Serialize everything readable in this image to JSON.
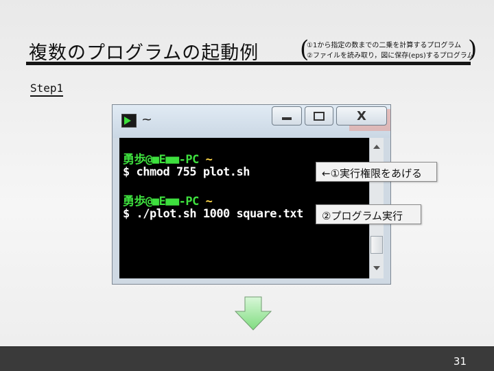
{
  "slide": {
    "title": "複数のプログラムの起動例",
    "paren_open": "(",
    "paren_close": ")",
    "note_line1": "①1から指定の数までの二乗を計算するプログラム",
    "note_line2": "②ファイルを読み取り，図に保存(eps)するプログラム",
    "step_label": "Step1",
    "page_number": "31"
  },
  "terminal": {
    "title": "~",
    "lines": [
      {
        "user": "勇歩@■E■■-PC",
        "cwd": "~"
      },
      {
        "prompt": "$",
        "command": "chmod 755 plot.sh"
      },
      {
        "user": "勇歩@■E■■-PC",
        "cwd": "~"
      },
      {
        "prompt": "$",
        "command": "./plot.sh 1000 square.txt"
      }
    ],
    "close_glyph": "X"
  },
  "callouts": {
    "c1": "←①実行権限をあげる",
    "c2": "②プログラム実行"
  },
  "colors": {
    "terminal_bg": "#000000",
    "prompt_green": "#3ee03e",
    "tilde_yellow": "#ffd84a",
    "arrow_fill": "#9be89b",
    "footer_bg": "#3a3a3a"
  }
}
